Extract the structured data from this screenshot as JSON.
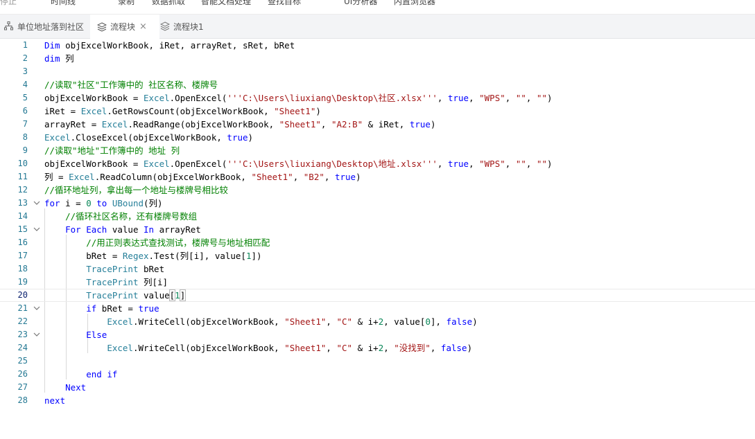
{
  "toolbar": {
    "stop": "停止",
    "timeline": "时间线",
    "record": "录制",
    "data_scrape": "数据抓取",
    "smart_doc": "智能文档处理",
    "find_target": "查找目标",
    "ui_analyzer": "UI分析器",
    "builtin_browser": "内置浏览器"
  },
  "tabs": [
    {
      "label": "单位地址落到社区",
      "icon": "flow-chart-icon"
    },
    {
      "label": "流程块",
      "icon": "layers-icon",
      "active": true
    },
    {
      "label": "流程块1",
      "icon": "layers-icon"
    }
  ],
  "editor": {
    "current_line": 20,
    "line_numbers": [
      "1",
      "2",
      "3",
      "4",
      "5",
      "6",
      "7",
      "8",
      "9",
      "10",
      "11",
      "12",
      "13",
      "14",
      "15",
      "16",
      "17",
      "18",
      "19",
      "20",
      "21",
      "22",
      "23",
      "24",
      "25",
      "26",
      "27",
      "28"
    ],
    "lines": [
      [
        [
          "kw",
          "Dim"
        ],
        [
          "op",
          " objExcelWorkBook, iRet, arrayRet, sRet, bRet"
        ]
      ],
      [
        [
          "kw",
          "dim"
        ],
        [
          "op",
          " 列"
        ]
      ],
      [],
      [
        [
          "cmt",
          "//读取\"社区\"工作簿中的 社区名称、楼牌号"
        ]
      ],
      [
        [
          "op",
          "objExcelWorkBook = "
        ],
        [
          "obj",
          "Excel"
        ],
        [
          "op",
          ".OpenExcel("
        ],
        [
          "str",
          "'''C:\\Users\\liuxiang\\Desktop\\社区.xlsx'''"
        ],
        [
          "op",
          ", "
        ],
        [
          "kw",
          "true"
        ],
        [
          "op",
          ", "
        ],
        [
          "str",
          "\"WPS\""
        ],
        [
          "op",
          ", "
        ],
        [
          "str",
          "\"\""
        ],
        [
          "op",
          ", "
        ],
        [
          "str",
          "\"\""
        ],
        [
          "op",
          ")"
        ]
      ],
      [
        [
          "op",
          "iRet = "
        ],
        [
          "obj",
          "Excel"
        ],
        [
          "op",
          ".GetRowsCount(objExcelWorkBook, "
        ],
        [
          "str",
          "\"Sheet1\""
        ],
        [
          "op",
          ")"
        ]
      ],
      [
        [
          "op",
          "arrayRet = "
        ],
        [
          "obj",
          "Excel"
        ],
        [
          "op",
          ".ReadRange(objExcelWorkBook, "
        ],
        [
          "str",
          "\"Sheet1\""
        ],
        [
          "op",
          ", "
        ],
        [
          "str",
          "\"A2:B\""
        ],
        [
          "op",
          " & iRet, "
        ],
        [
          "kw",
          "true"
        ],
        [
          "op",
          ")"
        ]
      ],
      [
        [
          "obj",
          "Excel"
        ],
        [
          "op",
          ".CloseExcel(objExcelWorkBook, "
        ],
        [
          "kw",
          "true"
        ],
        [
          "op",
          ")"
        ]
      ],
      [
        [
          "cmt",
          "//读取\"地址\"工作簿中的 地址 列"
        ]
      ],
      [
        [
          "op",
          "objExcelWorkBook = "
        ],
        [
          "obj",
          "Excel"
        ],
        [
          "op",
          ".OpenExcel("
        ],
        [
          "str",
          "'''C:\\Users\\liuxiang\\Desktop\\地址.xlsx'''"
        ],
        [
          "op",
          ", "
        ],
        [
          "kw",
          "true"
        ],
        [
          "op",
          ", "
        ],
        [
          "str",
          "\"WPS\""
        ],
        [
          "op",
          ", "
        ],
        [
          "str",
          "\"\""
        ],
        [
          "op",
          ", "
        ],
        [
          "str",
          "\"\""
        ],
        [
          "op",
          ")"
        ]
      ],
      [
        [
          "op",
          "列 = "
        ],
        [
          "obj",
          "Excel"
        ],
        [
          "op",
          ".ReadColumn(objExcelWorkBook, "
        ],
        [
          "str",
          "\"Sheet1\""
        ],
        [
          "op",
          ", "
        ],
        [
          "str",
          "\"B2\""
        ],
        [
          "op",
          ", "
        ],
        [
          "kw",
          "true"
        ],
        [
          "op",
          ")"
        ]
      ],
      [
        [
          "cmt",
          "//循环地址列，拿出每一个地址与楼牌号相比较"
        ]
      ],
      [
        [
          "kw",
          "for"
        ],
        [
          "op",
          " i = "
        ],
        [
          "num",
          "0"
        ],
        [
          "op",
          " "
        ],
        [
          "kw",
          "to"
        ],
        [
          "op",
          " "
        ],
        [
          "obj",
          "UBound"
        ],
        [
          "op",
          "(列)"
        ]
      ],
      [
        [
          "op",
          "    "
        ],
        [
          "cmt",
          "//循环社区名称，还有楼牌号数组"
        ]
      ],
      [
        [
          "op",
          "    "
        ],
        [
          "kw",
          "For Each"
        ],
        [
          "op",
          " value "
        ],
        [
          "kw",
          "In"
        ],
        [
          "op",
          " arrayRet"
        ]
      ],
      [
        [
          "op",
          "        "
        ],
        [
          "cmt",
          "//用正则表达式查找测试，楼牌号与地址相匹配"
        ]
      ],
      [
        [
          "op",
          "        bRet = "
        ],
        [
          "obj",
          "Regex"
        ],
        [
          "op",
          ".Test(列[i], value["
        ],
        [
          "num",
          "1"
        ],
        [
          "op",
          "])"
        ]
      ],
      [
        [
          "op",
          "        "
        ],
        [
          "obj",
          "TracePrint"
        ],
        [
          "op",
          " bRet"
        ]
      ],
      [
        [
          "op",
          "        "
        ],
        [
          "obj",
          "TracePrint"
        ],
        [
          "op",
          " 列[i]"
        ]
      ],
      [
        [
          "op",
          "        "
        ],
        [
          "obj",
          "TracePrint"
        ],
        [
          "op",
          " value"
        ],
        [
          "brk",
          "["
        ],
        [
          "num",
          "1"
        ],
        [
          "brk",
          "]"
        ]
      ],
      [
        [
          "op",
          "        "
        ],
        [
          "kw",
          "if"
        ],
        [
          "op",
          " bRet = "
        ],
        [
          "kw",
          "true"
        ]
      ],
      [
        [
          "op",
          "            "
        ],
        [
          "obj",
          "Excel"
        ],
        [
          "op",
          ".WriteCell(objExcelWorkBook, "
        ],
        [
          "str",
          "\"Sheet1\""
        ],
        [
          "op",
          ", "
        ],
        [
          "str",
          "\"C\""
        ],
        [
          "op",
          " & i+"
        ],
        [
          "num",
          "2"
        ],
        [
          "op",
          ", value["
        ],
        [
          "num",
          "0"
        ],
        [
          "op",
          "], "
        ],
        [
          "kw",
          "false"
        ],
        [
          "op",
          ")"
        ]
      ],
      [
        [
          "op",
          "        "
        ],
        [
          "kw",
          "Else"
        ]
      ],
      [
        [
          "op",
          "            "
        ],
        [
          "obj",
          "Excel"
        ],
        [
          "op",
          ".WriteCell(objExcelWorkBook, "
        ],
        [
          "str",
          "\"Sheet1\""
        ],
        [
          "op",
          ", "
        ],
        [
          "str",
          "\"C\""
        ],
        [
          "op",
          " & i+"
        ],
        [
          "num",
          "2"
        ],
        [
          "op",
          ", "
        ],
        [
          "str",
          "\"没找到\""
        ],
        [
          "op",
          ", "
        ],
        [
          "kw",
          "false"
        ],
        [
          "op",
          ")"
        ]
      ],
      [],
      [
        [
          "op",
          "        "
        ],
        [
          "kw",
          "end if"
        ]
      ],
      [
        [
          "op",
          "    "
        ],
        [
          "kw",
          "Next"
        ]
      ],
      [
        [
          "kw",
          "next"
        ]
      ]
    ],
    "fold_lines": [
      13,
      15,
      21,
      23
    ]
  }
}
